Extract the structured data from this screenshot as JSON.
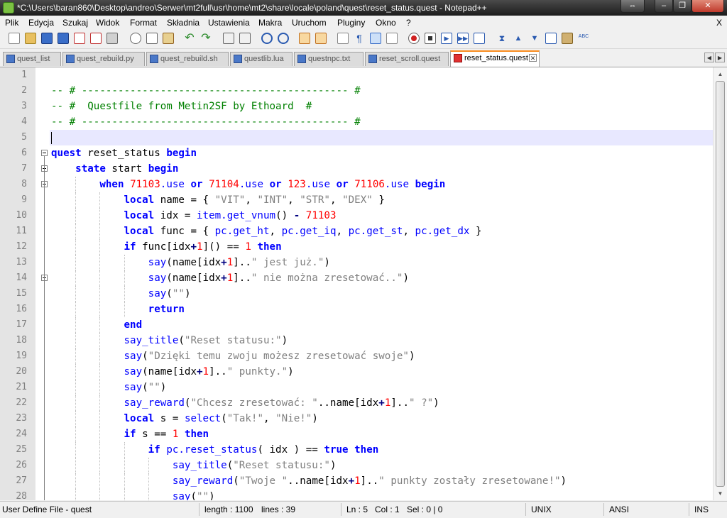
{
  "window": {
    "title": "*C:\\Users\\baran860\\Desktop\\andreo\\Serwer\\mt2full\\usr\\home\\mt2\\share\\locale\\poland\\quest\\reset_status.quest - Notepad++"
  },
  "menu": {
    "items": [
      "Plik",
      "Edycja",
      "Szukaj",
      "Widok",
      "Format",
      "Składnia",
      "Ustawienia",
      "Makra",
      "Uruchom",
      "Pluginy",
      "Okno",
      "?"
    ],
    "close": "X"
  },
  "tabs": [
    {
      "label": "quest_list",
      "active": false
    },
    {
      "label": "quest_rebuild.py",
      "active": false
    },
    {
      "label": "quest_rebuild.sh",
      "active": false
    },
    {
      "label": "questlib.lua",
      "active": false
    },
    {
      "label": "questnpc.txt",
      "active": false
    },
    {
      "label": "reset_scroll.quest",
      "active": false
    },
    {
      "label": "reset_status.quest",
      "active": true
    }
  ],
  "editor": {
    "current_line": 5,
    "lines": [
      [],
      [
        [
          "cm",
          "-- # -------------------------------------------- #"
        ]
      ],
      [
        [
          "cm",
          "-- #  Questfile from Metin2SF by Ethoard  #"
        ]
      ],
      [
        [
          "cm",
          "-- # -------------------------------------------- #"
        ]
      ],
      [],
      [
        [
          "kw",
          "quest"
        ],
        [
          "tx",
          " reset_status "
        ],
        [
          "kw",
          "begin"
        ]
      ],
      [
        [
          "tx",
          "    "
        ],
        [
          "kw",
          "state"
        ],
        [
          "tx",
          " start "
        ],
        [
          "kw",
          "begin"
        ]
      ],
      [
        [
          "tx",
          "        "
        ],
        [
          "kw",
          "when"
        ],
        [
          "tx",
          " "
        ],
        [
          "num",
          "71103"
        ],
        [
          "fn",
          ".use"
        ],
        [
          "tx",
          " "
        ],
        [
          "kw",
          "or"
        ],
        [
          "tx",
          " "
        ],
        [
          "num",
          "71104"
        ],
        [
          "fn",
          ".use"
        ],
        [
          "tx",
          " "
        ],
        [
          "kw",
          "or"
        ],
        [
          "tx",
          " "
        ],
        [
          "num",
          "123"
        ],
        [
          "fn",
          ".use"
        ],
        [
          "tx",
          " "
        ],
        [
          "kw",
          "or"
        ],
        [
          "tx",
          " "
        ],
        [
          "num",
          "71106"
        ],
        [
          "fn",
          ".use"
        ],
        [
          "tx",
          " "
        ],
        [
          "kw",
          "begin"
        ]
      ],
      [
        [
          "tx",
          "            "
        ],
        [
          "kw",
          "local"
        ],
        [
          "tx",
          " name = { "
        ],
        [
          "str",
          "\"VIT\""
        ],
        [
          "tx",
          ", "
        ],
        [
          "str",
          "\"INT\""
        ],
        [
          "tx",
          ", "
        ],
        [
          "str",
          "\"STR\""
        ],
        [
          "tx",
          ", "
        ],
        [
          "str",
          "\"DEX\""
        ],
        [
          "tx",
          " }"
        ]
      ],
      [
        [
          "tx",
          "            "
        ],
        [
          "kw",
          "local"
        ],
        [
          "tx",
          " idx = "
        ],
        [
          "fn",
          "item.get_vnum"
        ],
        [
          "tx",
          "() "
        ],
        [
          "op",
          "-"
        ],
        [
          "tx",
          " "
        ],
        [
          "num",
          "71103"
        ]
      ],
      [
        [
          "tx",
          "            "
        ],
        [
          "kw",
          "local"
        ],
        [
          "tx",
          " func = { "
        ],
        [
          "fn",
          "pc.get_ht"
        ],
        [
          "tx",
          ", "
        ],
        [
          "fn",
          "pc.get_iq"
        ],
        [
          "tx",
          ", "
        ],
        [
          "fn",
          "pc.get_st"
        ],
        [
          "tx",
          ", "
        ],
        [
          "fn",
          "pc.get_dx"
        ],
        [
          "tx",
          " }"
        ]
      ],
      [
        [
          "tx",
          "            "
        ],
        [
          "kw",
          "if"
        ],
        [
          "tx",
          " func[idx"
        ],
        [
          "op",
          "+"
        ],
        [
          "num",
          "1"
        ],
        [
          "tx",
          "]() == "
        ],
        [
          "num",
          "1"
        ],
        [
          "tx",
          " "
        ],
        [
          "kw",
          "then"
        ]
      ],
      [
        [
          "tx",
          "                "
        ],
        [
          "fn",
          "say"
        ],
        [
          "tx",
          "(name[idx"
        ],
        [
          "op",
          "+"
        ],
        [
          "num",
          "1"
        ],
        [
          "tx",
          "].."
        ],
        [
          "str",
          "\" jest już.\""
        ],
        [
          "tx",
          ")"
        ]
      ],
      [
        [
          "tx",
          "                "
        ],
        [
          "fn",
          "say"
        ],
        [
          "tx",
          "(name[idx"
        ],
        [
          "op",
          "+"
        ],
        [
          "num",
          "1"
        ],
        [
          "tx",
          "].."
        ],
        [
          "str",
          "\" nie można zresetować..\""
        ],
        [
          "tx",
          ")"
        ]
      ],
      [
        [
          "tx",
          "                "
        ],
        [
          "fn",
          "say"
        ],
        [
          "tx",
          "("
        ],
        [
          "str",
          "\"\""
        ],
        [
          "tx",
          ")"
        ]
      ],
      [
        [
          "tx",
          "                "
        ],
        [
          "kw",
          "return"
        ]
      ],
      [
        [
          "tx",
          "            "
        ],
        [
          "kw",
          "end"
        ]
      ],
      [
        [
          "tx",
          "            "
        ],
        [
          "fn",
          "say_title"
        ],
        [
          "tx",
          "("
        ],
        [
          "str",
          "\"Reset statusu:\""
        ],
        [
          "tx",
          ")"
        ]
      ],
      [
        [
          "tx",
          "            "
        ],
        [
          "fn",
          "say"
        ],
        [
          "tx",
          "("
        ],
        [
          "str",
          "\"Dzięki temu zwoju możesz zresetować swoje\""
        ],
        [
          "tx",
          ")"
        ]
      ],
      [
        [
          "tx",
          "            "
        ],
        [
          "fn",
          "say"
        ],
        [
          "tx",
          "(name[idx"
        ],
        [
          "op",
          "+"
        ],
        [
          "num",
          "1"
        ],
        [
          "tx",
          "].."
        ],
        [
          "str",
          "\" punkty.\""
        ],
        [
          "tx",
          ")"
        ]
      ],
      [
        [
          "tx",
          "            "
        ],
        [
          "fn",
          "say"
        ],
        [
          "tx",
          "("
        ],
        [
          "str",
          "\"\""
        ],
        [
          "tx",
          ")"
        ]
      ],
      [
        [
          "tx",
          "            "
        ],
        [
          "fn",
          "say_reward"
        ],
        [
          "tx",
          "("
        ],
        [
          "str",
          "\"Chcesz zresetować: \""
        ],
        [
          "tx",
          "..name[idx"
        ],
        [
          "op",
          "+"
        ],
        [
          "num",
          "1"
        ],
        [
          "tx",
          "].."
        ],
        [
          "str",
          "\" ?\""
        ],
        [
          "tx",
          ")"
        ]
      ],
      [
        [
          "tx",
          "            "
        ],
        [
          "kw",
          "local"
        ],
        [
          "tx",
          " s = "
        ],
        [
          "fn",
          "select"
        ],
        [
          "tx",
          "("
        ],
        [
          "str",
          "\"Tak!\""
        ],
        [
          "tx",
          ", "
        ],
        [
          "str",
          "\"Nie!\""
        ],
        [
          "tx",
          ")"
        ]
      ],
      [
        [
          "tx",
          "            "
        ],
        [
          "kw",
          "if"
        ],
        [
          "tx",
          " s == "
        ],
        [
          "num",
          "1"
        ],
        [
          "tx",
          " "
        ],
        [
          "kw",
          "then"
        ]
      ],
      [
        [
          "tx",
          "                "
        ],
        [
          "kw",
          "if"
        ],
        [
          "tx",
          " "
        ],
        [
          "fn",
          "pc.reset_status"
        ],
        [
          "tx",
          "( idx ) == "
        ],
        [
          "kw",
          "true"
        ],
        [
          "tx",
          " "
        ],
        [
          "kw",
          "then"
        ]
      ],
      [
        [
          "tx",
          "                    "
        ],
        [
          "fn",
          "say_title"
        ],
        [
          "tx",
          "("
        ],
        [
          "str",
          "\"Reset statusu:\""
        ],
        [
          "tx",
          ")"
        ]
      ],
      [
        [
          "tx",
          "                    "
        ],
        [
          "fn",
          "say_reward"
        ],
        [
          "tx",
          "("
        ],
        [
          "str",
          "\"Twoje \""
        ],
        [
          "tx",
          "..name[idx"
        ],
        [
          "op",
          "+"
        ],
        [
          "num",
          "1"
        ],
        [
          "tx",
          "].."
        ],
        [
          "str",
          "\" punkty zostały zresetowane!\""
        ],
        [
          "tx",
          ")"
        ]
      ],
      [
        [
          "tx",
          "                    "
        ],
        [
          "fn",
          "say"
        ],
        [
          "tx",
          "("
        ],
        [
          "str",
          "\"\""
        ],
        [
          "tx",
          ")"
        ]
      ]
    ]
  },
  "status": {
    "file_type": "User Define File - quest",
    "length": "length : 1100",
    "lines": "lines : 39",
    "ln": "Ln : 5",
    "col": "Col : 1",
    "sel": "Sel : 0 | 0",
    "eol": "UNIX",
    "encoding": "ANSI",
    "mode": "INS"
  }
}
